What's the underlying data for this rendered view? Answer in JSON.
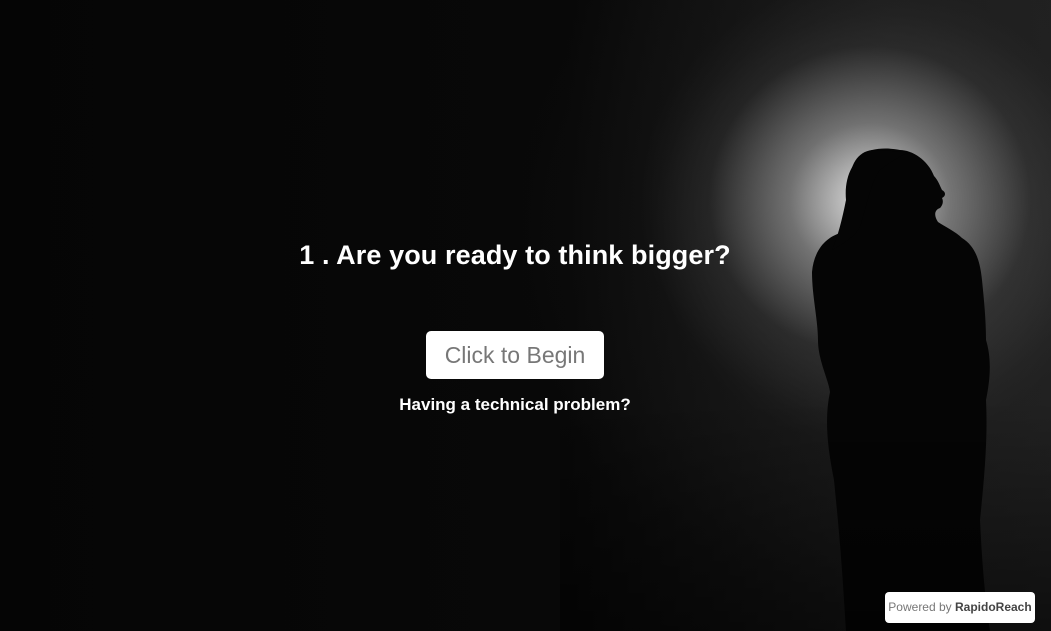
{
  "survey": {
    "question_number": "1",
    "question_text": "1 . Are you ready to think bigger?",
    "begin_button_label": "Click to Begin",
    "technical_problem_link": "Having a technical problem?"
  },
  "footer": {
    "powered_by_prefix": "Powered by",
    "brand_name": "RapidoReach"
  },
  "background": {
    "image_subject": "backlit-woman-silhouette",
    "base_color": "#060606"
  },
  "colors": {
    "question_text": "#ffffff",
    "button_background": "#ffffff",
    "button_text": "#777777",
    "link_text": "#ffffff"
  }
}
